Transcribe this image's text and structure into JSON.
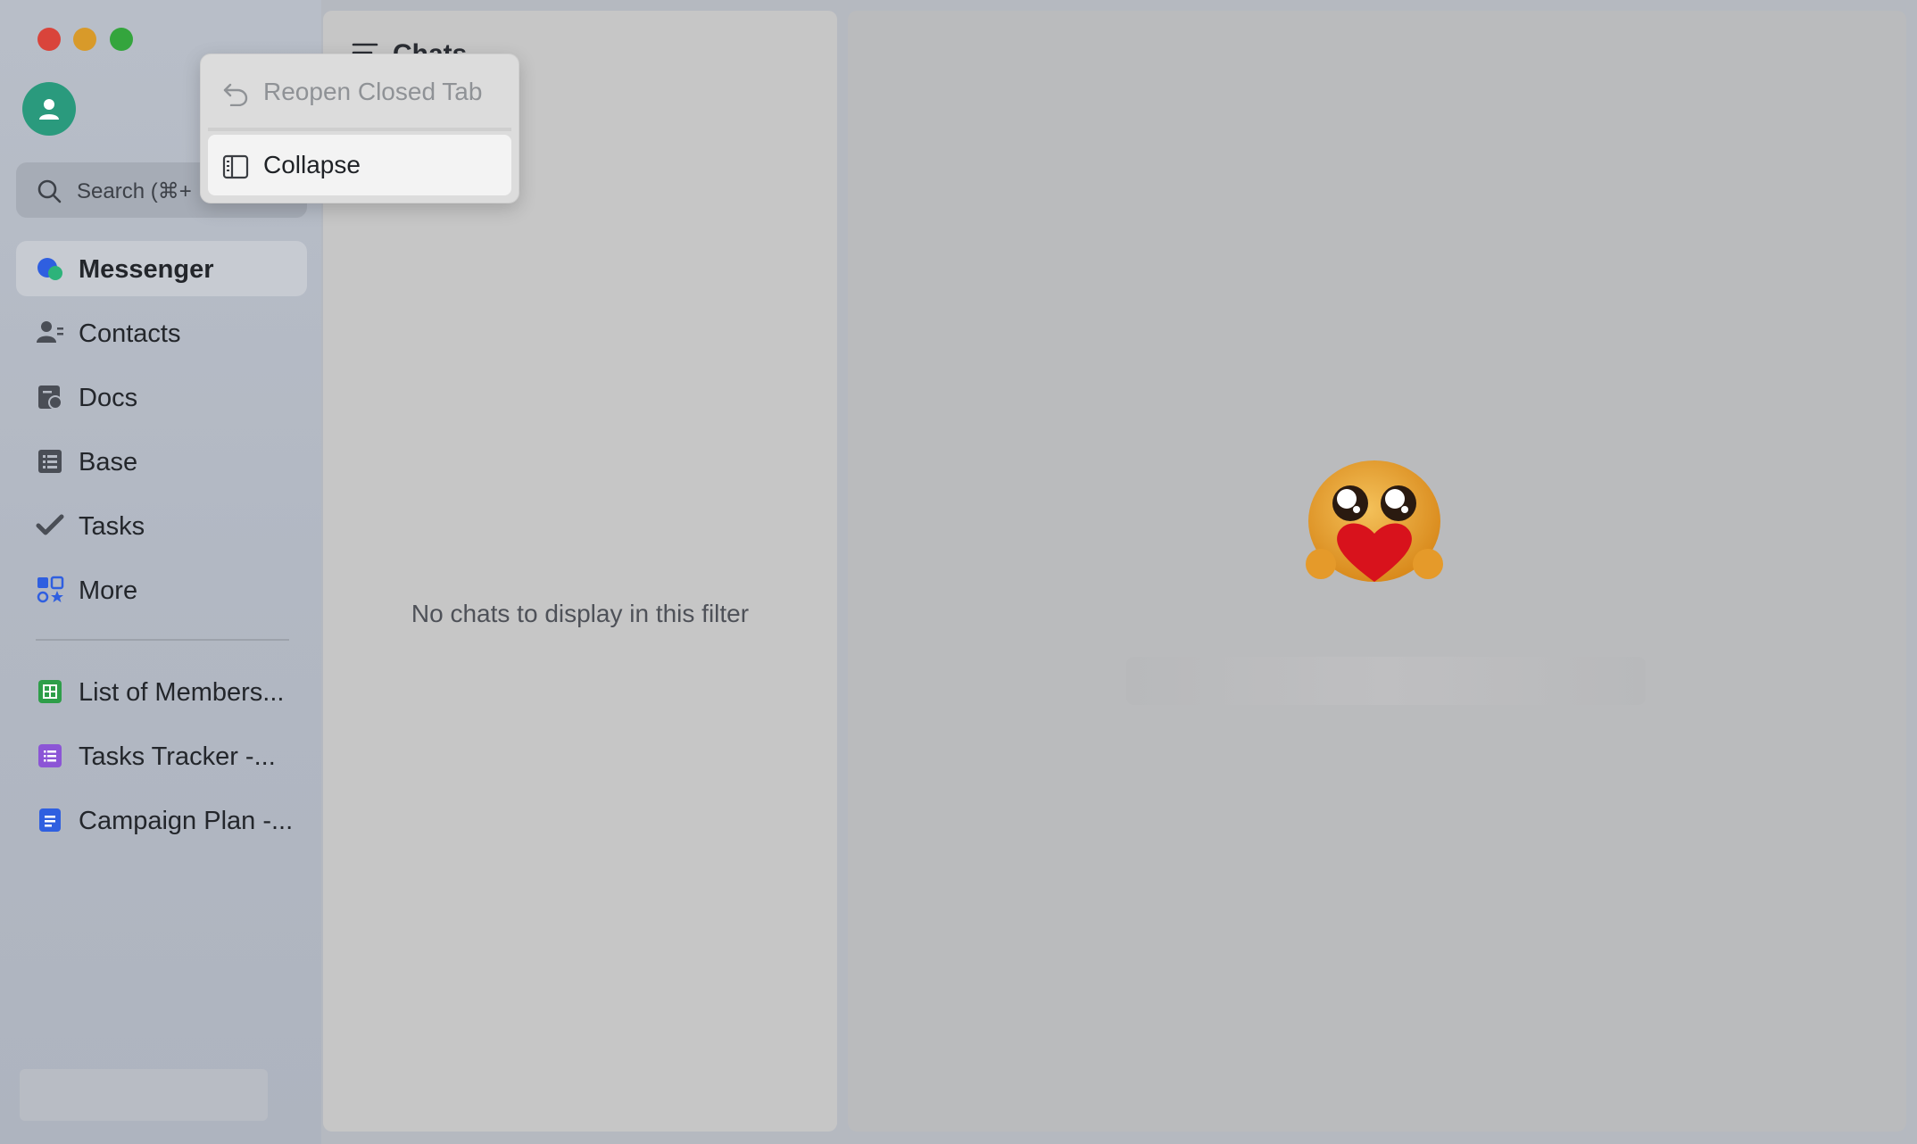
{
  "sidebar": {
    "search": {
      "label": "Search (⌘+"
    },
    "nav": [
      {
        "label": "Messenger",
        "icon": "messenger-icon"
      },
      {
        "label": "Contacts",
        "icon": "contacts-icon"
      },
      {
        "label": "Docs",
        "icon": "docs-icon"
      },
      {
        "label": "Base",
        "icon": "base-icon"
      },
      {
        "label": "Tasks",
        "icon": "tasks-icon"
      },
      {
        "label": "More",
        "icon": "more-apps-icon"
      }
    ],
    "pinned": [
      {
        "label": "List of Members...",
        "icon": "sheet-icon",
        "color": "#2e9e49"
      },
      {
        "label": "Tasks Tracker -...",
        "icon": "list-icon",
        "color": "#8c55d6"
      },
      {
        "label": "Campaign Plan -...",
        "icon": "doc-icon",
        "color": "#2f5fe0"
      }
    ]
  },
  "chat_panel": {
    "title": "Chats",
    "empty_message": "No chats to display in this filter"
  },
  "context_menu": {
    "items": [
      {
        "label": "Reopen Closed Tab",
        "icon": "undo-icon",
        "enabled": false
      },
      {
        "label": "Collapse",
        "icon": "sidebar-collapse-icon",
        "enabled": true
      }
    ]
  },
  "colors": {
    "avatar": "#2a9a7d",
    "traffic_red": "#d9443b",
    "traffic_yellow": "#d89a2a",
    "traffic_green": "#34a53d"
  }
}
